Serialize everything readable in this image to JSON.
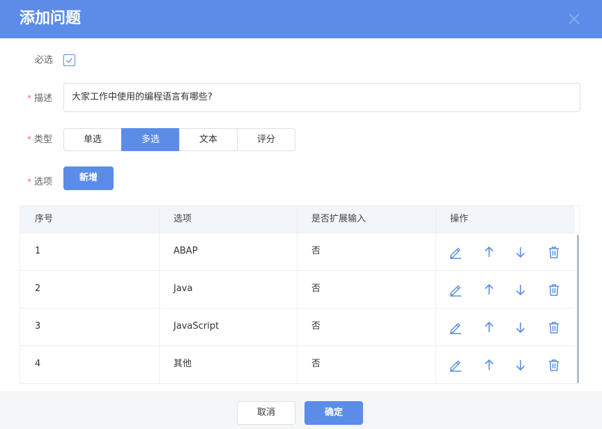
{
  "dialog": {
    "title": "添加问题",
    "close_icon": "close-icon"
  },
  "form": {
    "required_label": "必选",
    "required_checked": true,
    "desc_label": "描述",
    "desc_value": "大家工作中使用的编程语言有哪些?",
    "type_label": "类型",
    "type_options": [
      "单选",
      "多选",
      "文本",
      "评分"
    ],
    "type_selected": "多选",
    "options_label": "选项",
    "add_button": "新增",
    "required_mark": "*"
  },
  "table": {
    "headers": [
      "序号",
      "选项",
      "是否扩展输入",
      "操作"
    ],
    "rows": [
      {
        "index": "1",
        "option": "ABAP",
        "extend": "否"
      },
      {
        "index": "2",
        "option": "Java",
        "extend": "否"
      },
      {
        "index": "3",
        "option": "JavaScript",
        "extend": "否"
      },
      {
        "index": "4",
        "option": "其他",
        "extend": "否"
      }
    ],
    "action_icons": [
      "edit-icon",
      "arrow-up-icon",
      "arrow-down-icon",
      "trash-icon"
    ]
  },
  "footer": {
    "cancel_label": "取消",
    "ok_label": "确定"
  },
  "colors": {
    "primary": "#5b8de8",
    "required": "#f56c6c",
    "header_bg": "#f2f5fa"
  }
}
